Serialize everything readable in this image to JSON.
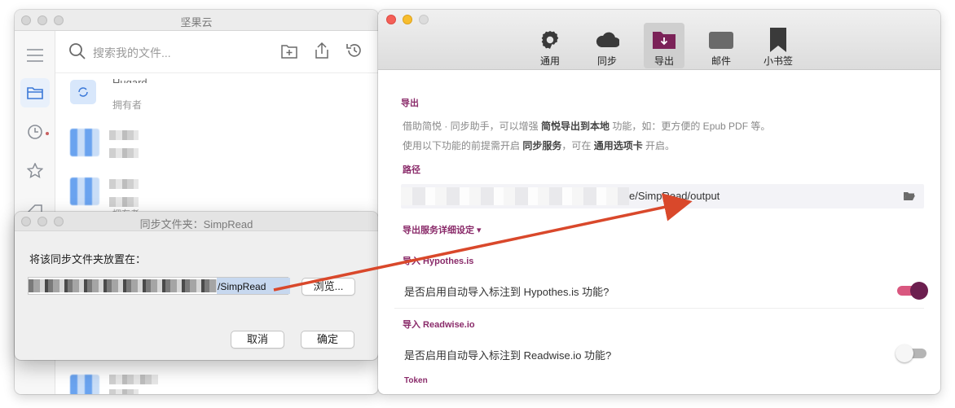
{
  "left_window": {
    "title": "坚果云",
    "search_placeholder": "搜索我的文件...",
    "files": [
      {
        "name": "Hugard",
        "sub": "拥有者"
      },
      {
        "name": "",
        "sub": ""
      },
      {
        "name": "",
        "sub": "拥有者"
      }
    ]
  },
  "dialog": {
    "title": "同步文件夹：SimpRead",
    "label": "将该同步文件夹放置在：",
    "path_visible": "/SimpRead",
    "browse_label": "浏览...",
    "cancel_label": "取消",
    "ok_label": "确定"
  },
  "right_window": {
    "tabs": [
      {
        "label": "通用",
        "icon": "gear-icon"
      },
      {
        "label": "同步",
        "icon": "cloud-icon"
      },
      {
        "label": "导出",
        "icon": "export-folder-icon",
        "active": true
      },
      {
        "label": "邮件",
        "icon": "mail-icon"
      },
      {
        "label": "小书签",
        "icon": "bookmark-icon"
      }
    ],
    "export_heading": "导出",
    "desc1_a": "借助简悦 · 同步助手，可以增强 ",
    "desc1_b": "简悦导出到本地",
    "desc1_c": " 功能，如：更方便的 Epub PDF 等。",
    "desc2_a": "使用以下功能的前提需开启 ",
    "desc2_b": "同步服务",
    "desc2_c": "，可在 ",
    "desc2_d": "通用选项卡",
    "desc2_e": " 开启。",
    "path_heading": "路径",
    "path_visible": "e/SimpRead/output",
    "details_label": "导出服务详细设定 ▾",
    "hypothes_heading": "导入 Hypothes.is",
    "hypothes_option": "是否启用自动导入标注到 Hypothes.is 功能?",
    "hypothes_enabled": true,
    "readwise_heading": "导入 Readwise.io",
    "readwise_option": "是否启用自动导入标注到 Readwise.io 功能?",
    "readwise_enabled": false,
    "token_heading": "Token"
  },
  "colors": {
    "accent": "#8a2b6a",
    "toggle_on_track": "#d9577f",
    "toggle_on_knob": "#6c1f4f",
    "arrow": "#d9482b"
  }
}
